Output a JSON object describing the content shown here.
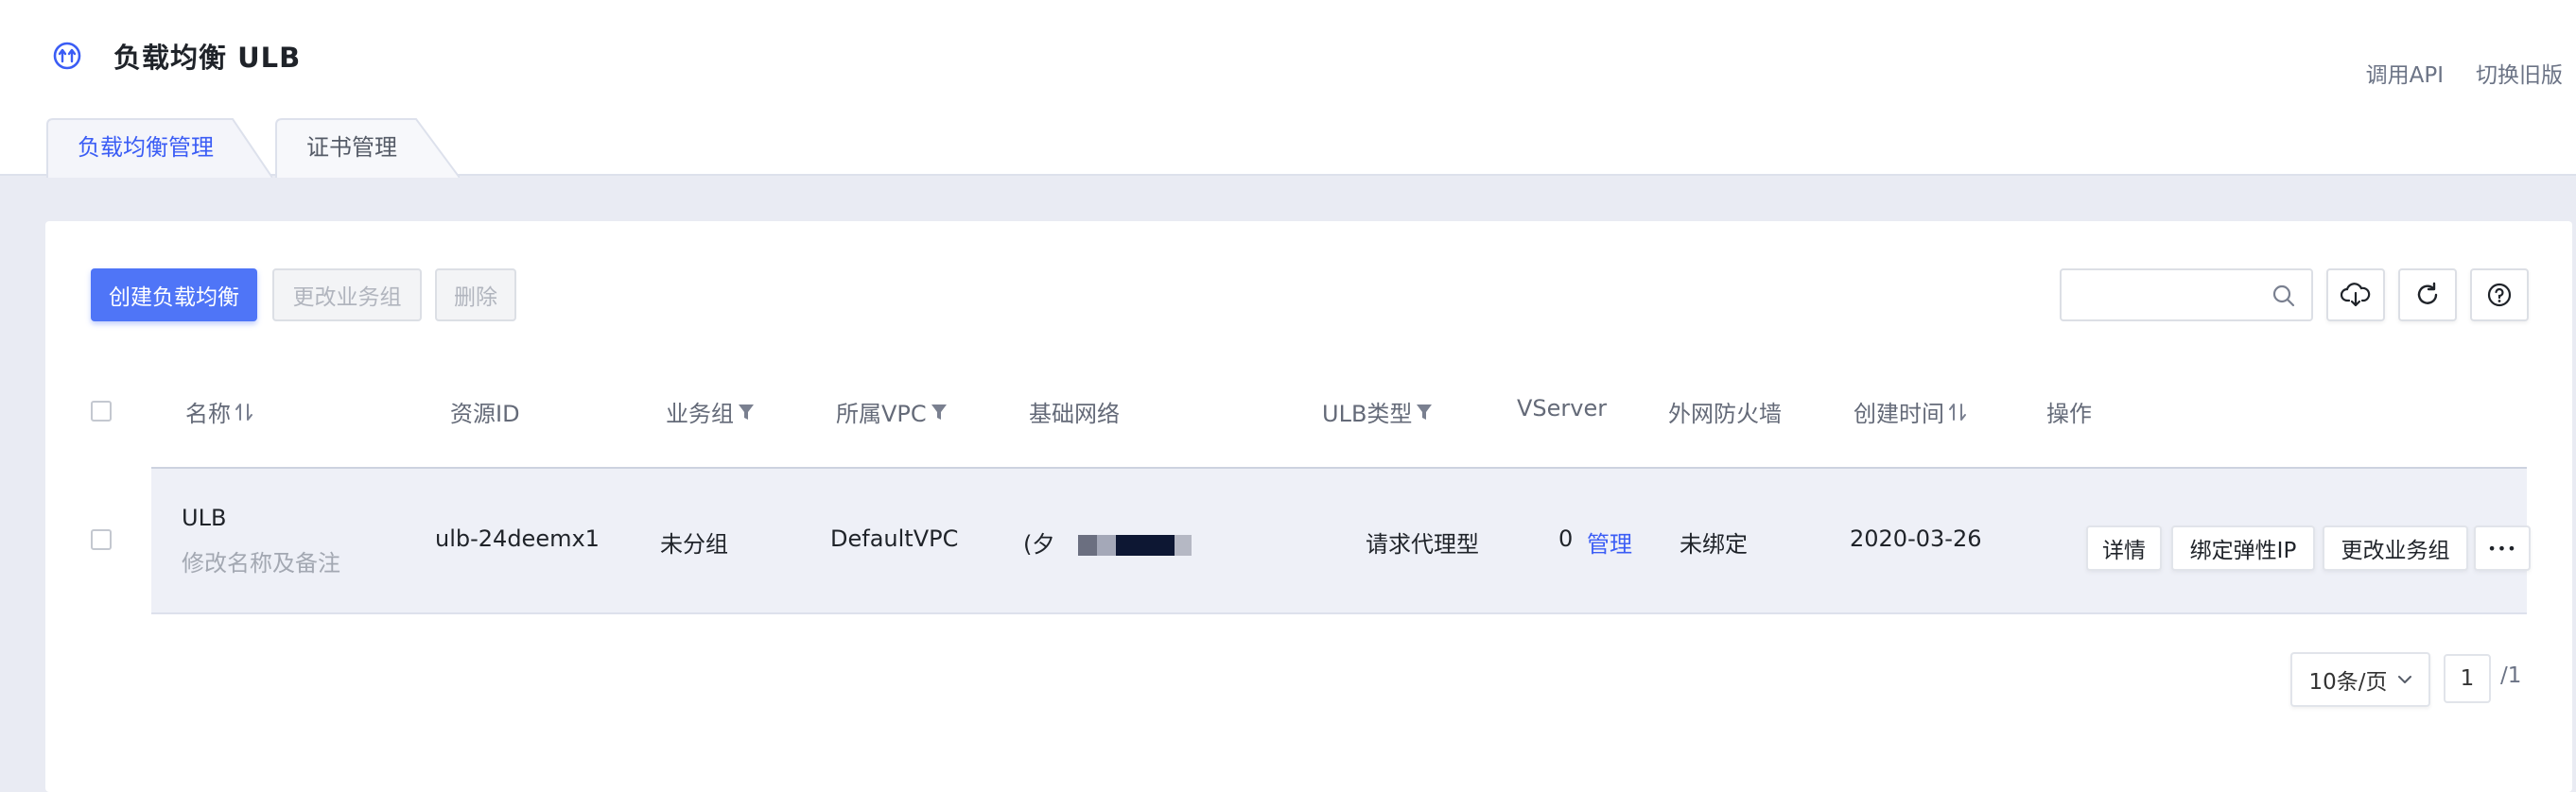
{
  "header": {
    "title": "负载均衡 ULB",
    "links": {
      "api": "调用API",
      "old_version": "切换旧版"
    }
  },
  "tabs": [
    {
      "label": "负载均衡管理",
      "active": true
    },
    {
      "label": "证书管理",
      "active": false
    }
  ],
  "toolbar": {
    "create_label": "创建负载均衡",
    "change_group_label": "更改业务组",
    "delete_label": "删除",
    "search_placeholder": ""
  },
  "table": {
    "columns": {
      "name": "名称",
      "resource_id": "资源ID",
      "group": "业务组",
      "vpc": "所属VPC",
      "network": "基础网络",
      "ulb_type": "ULB类型",
      "vserver": "VServer",
      "firewall": "外网防火墙",
      "created": "创建时间",
      "actions": "操作"
    },
    "rows": [
      {
        "name": "ULB",
        "name_sub": "修改名称及备注",
        "resource_id": "ulb-24deemx1",
        "group": "未分组",
        "vpc": "DefaultVPC",
        "network_prefix": "(夕",
        "ulb_type": "请求代理型",
        "vserver_count": "0",
        "vserver_link": "管理",
        "firewall": "未绑定",
        "created": "2020-03-26",
        "actions": {
          "detail": "详情",
          "bind_eip": "绑定弹性IP",
          "change_group": "更改业务组",
          "more": "•••"
        }
      }
    ]
  },
  "pagination": {
    "page_size": "10条/页",
    "current": "1",
    "total": "/1"
  },
  "colors": {
    "primary": "#4f75f7",
    "link": "#3b5df5",
    "row_bg": "#eef0f7",
    "page_bg": "#e9ebf3"
  }
}
